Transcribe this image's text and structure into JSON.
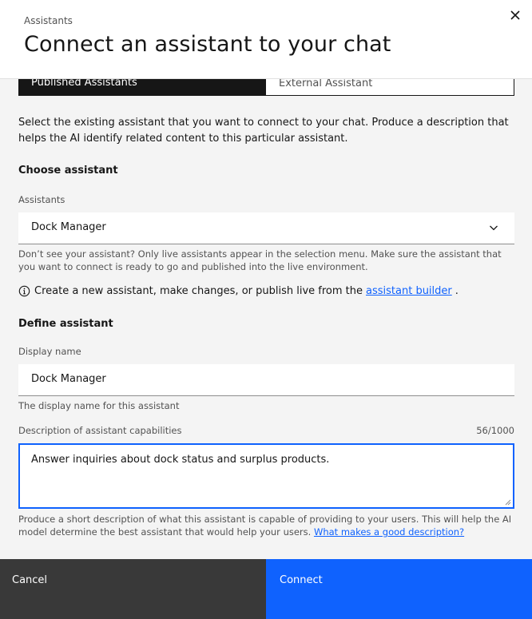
{
  "header": {
    "label": "Assistants",
    "title": "Connect an assistant to your chat"
  },
  "tabs": [
    {
      "label": "Published Assistants",
      "selected": true
    },
    {
      "label": "External Assistant",
      "selected": false
    }
  ],
  "intro": "Select the existing assistant that you want to connect to your chat. Produce a description that helps the AI identify related content to this particular assistant.",
  "choose": {
    "heading": "Choose assistant",
    "field_label": "Assistants",
    "selected_value": "Dock Manager",
    "helper": "Don’t see your assistant? Only live assistants appear in the selection menu. Make sure the assistant that you want to connect is ready to go and published into the live environment.",
    "info_text": "Create a new assistant, make changes, or publish live from the",
    "info_link": "assistant builder",
    "info_end": "."
  },
  "define": {
    "heading": "Define assistant",
    "display_label": "Display name",
    "display_value": "Dock Manager",
    "display_helper": "The display name for this assistant",
    "desc_label": "Description of assistant capabilities",
    "desc_counter": "56/1000",
    "desc_value": "Answer inquiries about dock status and surplus products.",
    "desc_helper": "Produce a short description of what this assistant is capable of providing to your users. This will help the AI model determine the best assistant that would help your users.",
    "desc_link": "What makes a good description?"
  },
  "footer": {
    "cancel": "Cancel",
    "connect": "Connect"
  },
  "colors": {
    "primary": "#0f62fe",
    "dark": "#161616",
    "cancel_bg": "#393939"
  }
}
